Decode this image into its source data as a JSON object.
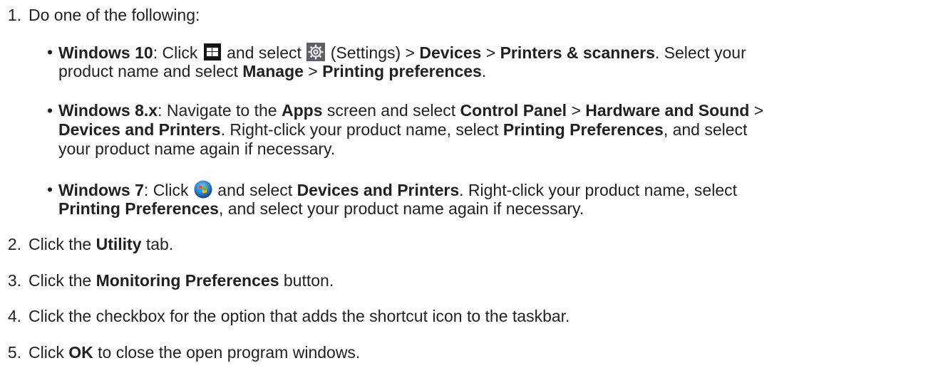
{
  "steps": [
    {
      "num": "1.",
      "text": "Do one of the following:"
    },
    {
      "num": "2.",
      "pre": "Click the ",
      "bold": "Utility",
      "post": " tab."
    },
    {
      "num": "3.",
      "pre": "Click the ",
      "bold": "Monitoring Preferences",
      "post": " button."
    },
    {
      "num": "4.",
      "text": "Click the checkbox for the option that adds the shortcut icon to the taskbar."
    },
    {
      "num": "5.",
      "pre": "Click ",
      "bold": "OK",
      "post": " to close the open program windows."
    }
  ],
  "bullet_marker": "•",
  "win10": {
    "os": "Windows 10",
    "sep1": ": Click ",
    "mid1": " and select ",
    "mid2": " (Settings) > ",
    "devices": "Devices",
    "gt1": " > ",
    "printers_scanners": "Printers & scanners",
    "after_ps": ". Select your",
    "line2_pre": "product name and select ",
    "manage": "Manage",
    "gt2": " > ",
    "printing_preferences": "Printing preferences",
    "end": ".",
    "icon_start": "windows-start-icon",
    "icon_settings": "gear-icon"
  },
  "win8": {
    "os": "Windows 8.x",
    "t1": ": Navigate to the ",
    "apps": "Apps",
    "t2": " screen and select ",
    "control_panel": "Control Panel",
    "gt1": " > ",
    "hardware_sound": "Hardware and Sound",
    "gt2": " >",
    "devices_printers": "Devices and Printers",
    "t3": ". Right-click your product name, select ",
    "printing_preferences": "Printing Preferences",
    "t4": ", and select",
    "line3": "your product name again if necessary."
  },
  "win7": {
    "os": "Windows 7",
    "t1": ": Click ",
    "t2": " and select ",
    "devices_printers": "Devices and Printers",
    "t3": ". Right-click your product name, select",
    "printing_preferences": "Printing Preferences",
    "t4": ", and select your product name again if necessary.",
    "icon_start": "windows7-start-orb-icon"
  }
}
